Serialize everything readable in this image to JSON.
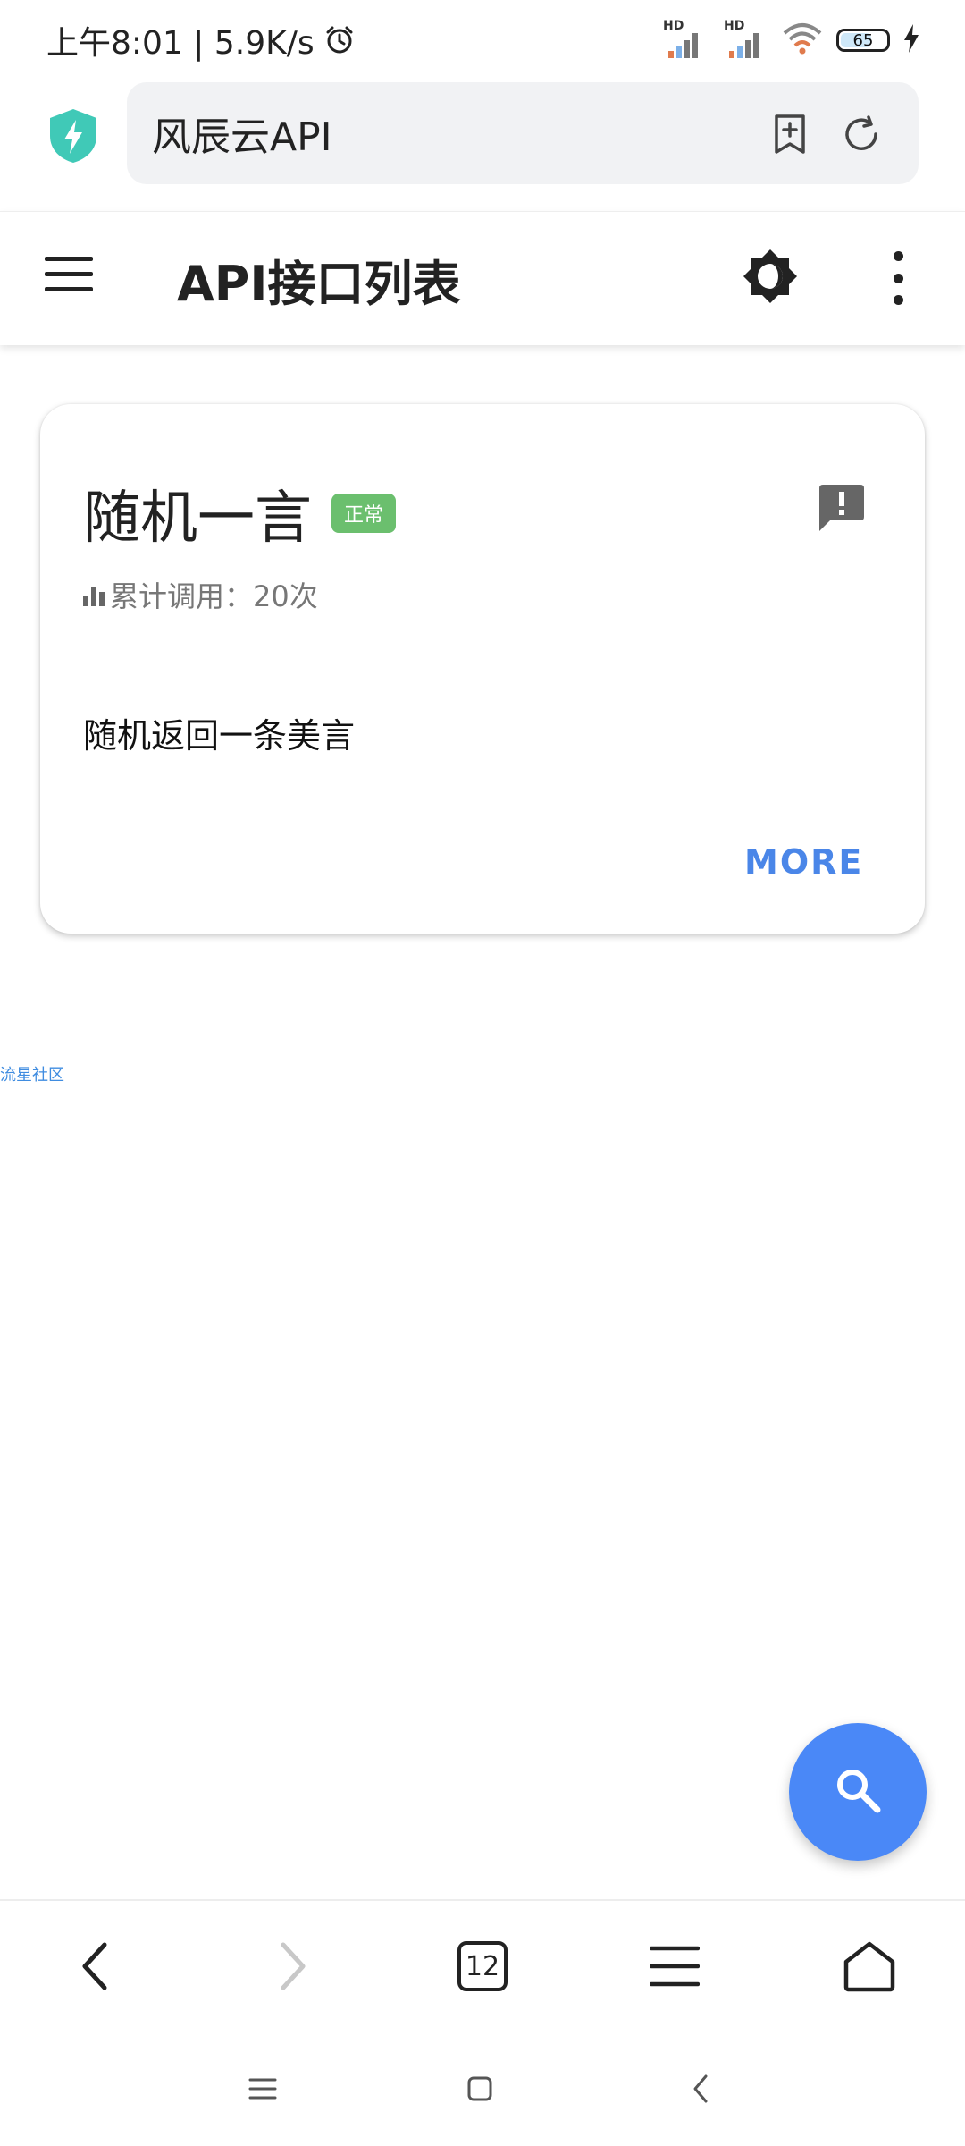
{
  "status_bar": {
    "time_speed": "上午8:01 | 5.9K/s",
    "signal_labels": [
      "HD",
      "HD"
    ],
    "battery_level": "65"
  },
  "browser": {
    "address_text": "风辰云API",
    "open_tabs_count": "12"
  },
  "app_bar": {
    "title": "API接口列表"
  },
  "api_card": {
    "title": "随机一言",
    "status_badge": "正常",
    "call_count_label": "累计调用：20次",
    "description": "随机返回一条美言",
    "more_label": "MORE"
  },
  "footer": {
    "link_text": "流星社区"
  },
  "colors": {
    "accent_blue": "#4a88f7",
    "badge_green": "#6bbf6e",
    "shield_teal": "#40c9b7"
  },
  "icons": {
    "address_bar": [
      "shield-icon",
      "bookmark-add-icon",
      "reload-icon"
    ],
    "app_bar": [
      "menu-icon",
      "brightness-icon",
      "more-vert-icon"
    ],
    "card": [
      "feedback-icon",
      "bar-chart-icon"
    ],
    "fab": "search-icon",
    "toolbar": [
      "back-icon",
      "forward-icon",
      "tabs-icon",
      "menu-icon",
      "home-icon"
    ],
    "system_nav": [
      "recent-apps-icon",
      "home-icon",
      "back-icon"
    ]
  }
}
